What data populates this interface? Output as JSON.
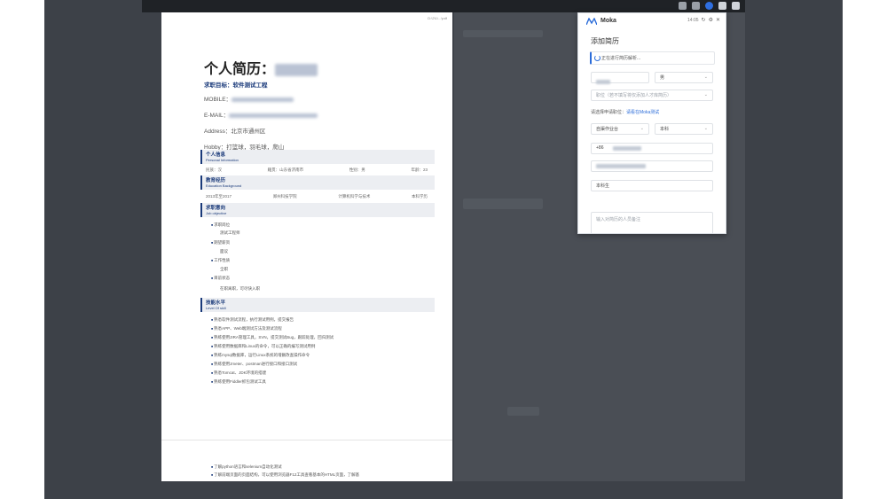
{
  "document": {
    "path": "D:\\2\\1\\...\\pdf",
    "title": "个人简历：",
    "objective": "求职目标：软件测试工程",
    "mobile_label": "MOBILE：",
    "email_label": "E-MAIL：",
    "address_label": "Address：",
    "address_value": "北京市通州区",
    "hobby_label": "Hobby：",
    "hobby_value": "打篮球，羽毛球，爬山",
    "sections": {
      "personal": {
        "title": "个人信息",
        "subtitle": "Personal Information"
      },
      "education": {
        "title": "教育经历",
        "subtitle": "Education Background"
      },
      "job": {
        "title": "求职意向",
        "subtitle": "Job objective"
      },
      "skills": {
        "title": "技能水平",
        "subtitle": "Level Of skill"
      }
    },
    "personal_row": [
      "民族：汉",
      "籍贯：山东省济南市",
      "性别：男",
      "年龄：23"
    ],
    "education_row": [
      "2013年至2017",
      "郑州科技学院",
      "计算机科学与技术",
      "本科学历"
    ],
    "job_items": [
      {
        "label": "求职岗位",
        "value": "测试工程师"
      },
      {
        "label": "期望薪资",
        "value": "面议"
      },
      {
        "label": "工作性质",
        "value": "全职"
      },
      {
        "label": "目前状态",
        "value": "在职离职，可尽快入职"
      }
    ],
    "skills": [
      "熟悉软件测试流程，执行测试用例，提交报告",
      "熟悉APP、Web端测试方法及测试流程",
      "熟练使用JIRA管理工具，SVN，提交测试Bug，跟踪处理，回归测试",
      "熟练使用数据库和Linux的命令，可以正确的编写测试用例",
      "熟练mysql数据库，运行Linux系统的增删改查操作命令",
      "熟练使用Jmeter、postman进行接口和接口测试",
      "熟悉Tomcat、JDK环境的搭建",
      "熟练使用Fiddler抓包测试工具"
    ],
    "skills_page2": [
      "了解python语言和selenium自动化测试",
      "了解前端页面的页面结构，可以使用浏览器F12工具查看基本的HTML页面，了解基"
    ]
  },
  "panel": {
    "brand": "Moka",
    "time": "14:05",
    "title": "添加简历",
    "status_text": "正在进行简历解析...",
    "gender_value": "男",
    "position_hint": "职位（若不填写将仅添加人才库简历）",
    "apply_label": "请选择申请职位：",
    "apply_link": "请看在Moka测试",
    "source_value": "自渠作业台",
    "tag_value": "本科",
    "phone_prefix": "+86",
    "school_value": "本科生",
    "textarea_placeholder": "输入对简历的人员备注",
    "colors": {
      "accent": "#2b6cd9",
      "resume_blue": "#1a3a7a"
    }
  }
}
